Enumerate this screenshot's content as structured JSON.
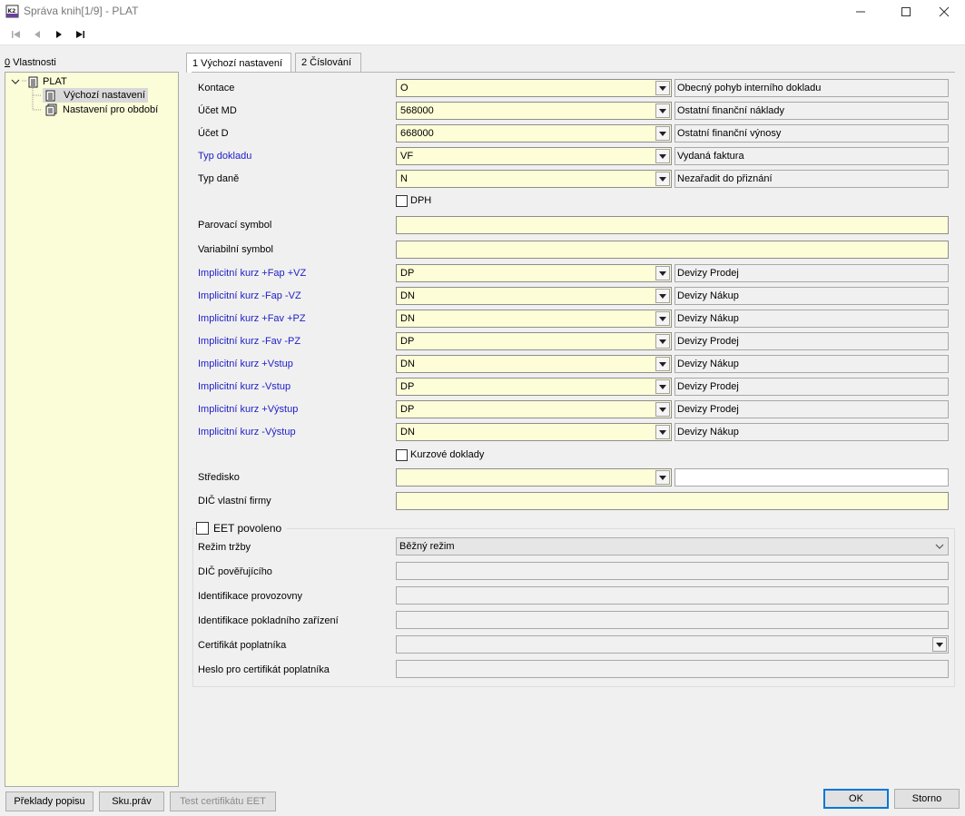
{
  "window": {
    "title": "Správa knih[1/9] - PLAT",
    "app_icon": "k2-app-icon",
    "controls": [
      "minimize-icon",
      "maximize-icon",
      "close-icon"
    ]
  },
  "toolbar": {
    "buttons": [
      "first-record-icon",
      "previous-record-icon",
      "next-record-icon",
      "last-record-icon"
    ]
  },
  "left_panel": {
    "label_key": "0",
    "label_rest": " Vlastnosti",
    "tree": {
      "root": "PLAT",
      "children": [
        "Výchozí nastavení",
        "Nastavení pro období"
      ],
      "selected_index": 0
    }
  },
  "tabs": [
    {
      "label": "1 Výchozí nastavení",
      "active": true
    },
    {
      "label": "2 Číslování",
      "active": false
    }
  ],
  "form": {
    "kontace": {
      "label": "Kontace",
      "value": "O",
      "desc": "Obecný pohyb interního dokladu"
    },
    "ucet_md": {
      "label": "Účet MD",
      "value": "568000",
      "desc": "Ostatní finanční náklady"
    },
    "ucet_d": {
      "label": "Účet D",
      "value": "668000",
      "desc": "Ostatní finanční výnosy"
    },
    "typ_dokladu": {
      "label": "Typ dokladu",
      "value": "VF",
      "desc": "Vydaná faktura"
    },
    "typ_dane": {
      "label": "Typ daně",
      "value": "N",
      "desc": "Nezařadit do přiznání"
    },
    "dph": {
      "label": "DPH",
      "checked": false
    },
    "parovaci_symbol": {
      "label": "Parovací symbol",
      "value": ""
    },
    "variabilni_symbol": {
      "label": "Variabilní symbol",
      "value": ""
    },
    "kurz_fap_vz_plus": {
      "label": "Implicitní kurz +Fap +VZ",
      "value": "DP",
      "desc": "Devizy Prodej"
    },
    "kurz_fap_vz_minus": {
      "label": "Implicitní kurz -Fap -VZ",
      "value": "DN",
      "desc": "Devizy Nákup"
    },
    "kurz_fav_pz_plus": {
      "label": "Implicitní kurz +Fav +PZ",
      "value": "DN",
      "desc": "Devizy Nákup"
    },
    "kurz_fav_pz_minus": {
      "label": "Implicitní kurz -Fav -PZ",
      "value": "DP",
      "desc": "Devizy Prodej"
    },
    "kurz_vstup_plus": {
      "label": "Implicitní kurz +Vstup",
      "value": "DN",
      "desc": "Devizy Nákup"
    },
    "kurz_vstup_minus": {
      "label": "Implicitní kurz -Vstup",
      "value": "DP",
      "desc": "Devizy Prodej"
    },
    "kurz_vystup_plus": {
      "label": "Implicitní kurz +Výstup",
      "value": "DP",
      "desc": "Devizy Prodej"
    },
    "kurz_vystup_minus": {
      "label": "Implicitní kurz -Výstup",
      "value": "DN",
      "desc": "Devizy Nákup"
    },
    "kurzove_doklady": {
      "label": "Kurzové doklady",
      "checked": false
    },
    "stredisko": {
      "label": "Středisko",
      "value": "",
      "desc": ""
    },
    "dic_firmy": {
      "label": "DIČ vlastní firmy",
      "value": ""
    }
  },
  "eet": {
    "enabled_label": "EET povoleno",
    "enabled": false,
    "rezim_trzby": {
      "label": "Režim tržby",
      "value": "Běžný režim"
    },
    "dic_poverujiciho": {
      "label": "DIČ pověřujícího",
      "value": ""
    },
    "identifikace_provozovny": {
      "label": "Identifikace provozovny",
      "value": ""
    },
    "identifikace_zarizeni": {
      "label": "Identifikace pokladního zařízení",
      "value": ""
    },
    "certifikat": {
      "label": "Certifikát poplatníka",
      "value": ""
    },
    "heslo": {
      "label": "Heslo pro certifikát poplatníka",
      "value": ""
    }
  },
  "buttons": {
    "preklady": "Překlady popisu",
    "sku_prav": "Sku.práv",
    "test_cert": "Test certifikátu EET",
    "ok": "OK",
    "storno": "Storno"
  },
  "colors": {
    "required_field": "#fdfdd7",
    "tree_background": "#fbfcd8",
    "link_label": "#2020c8"
  }
}
